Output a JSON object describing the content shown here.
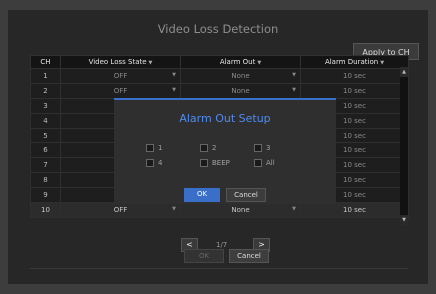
{
  "title": "Video Loss Detection",
  "apply_label": "Apply to CH",
  "headers": {
    "ch": "CH",
    "state": "Video Loss State",
    "alarm": "Alarm Out",
    "duration": "Alarm Duration"
  },
  "rows": [
    {
      "ch": "1",
      "state": "OFF",
      "alarm": "None",
      "duration": "10 sec"
    },
    {
      "ch": "2",
      "state": "OFF",
      "alarm": "None",
      "duration": "10 sec"
    },
    {
      "ch": "3",
      "state": "",
      "alarm": "",
      "duration": "10 sec"
    },
    {
      "ch": "4",
      "state": "",
      "alarm": "",
      "duration": "10 sec"
    },
    {
      "ch": "5",
      "state": "",
      "alarm": "",
      "duration": "10 sec"
    },
    {
      "ch": "6",
      "state": "",
      "alarm": "",
      "duration": "10 sec"
    },
    {
      "ch": "7",
      "state": "",
      "alarm": "",
      "duration": "10 sec"
    },
    {
      "ch": "8",
      "state": "",
      "alarm": "",
      "duration": "10 sec"
    },
    {
      "ch": "9",
      "state": "",
      "alarm": "",
      "duration": "10 sec"
    },
    {
      "ch": "10",
      "state": "OFF",
      "alarm": "None",
      "duration": "10 sec"
    }
  ],
  "pager": {
    "prev": "<",
    "text": "1/7",
    "next": ">"
  },
  "footer": {
    "ok": "OK",
    "cancel": "Cancel"
  },
  "modal": {
    "title": "Alarm Out Setup",
    "options": [
      "1",
      "2",
      "3",
      "4",
      "BEEP",
      "All"
    ],
    "ok": "OK",
    "cancel": "Cancel"
  },
  "colors": {
    "accent": "#3a6fc9",
    "modal_title": "#4f8cf0"
  }
}
